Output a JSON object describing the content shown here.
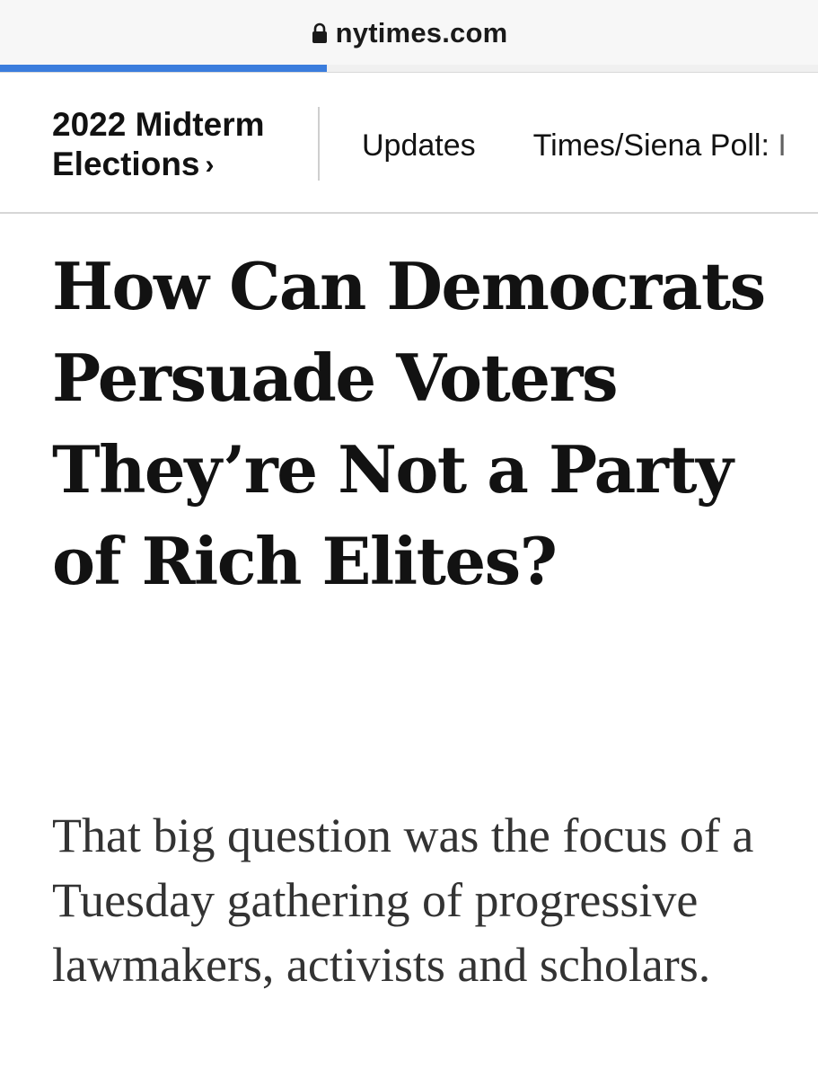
{
  "browser": {
    "url_text": "nytimes.com",
    "lock_icon": "lock-icon",
    "load_progress": 0.4,
    "accent_color": "#3b7ddd"
  },
  "section_nav": {
    "title": "2022 Midterm Elections",
    "chevron": "›",
    "links": [
      {
        "label": "Updates"
      },
      {
        "label": "Times/Siena Poll: I"
      }
    ]
  },
  "article": {
    "headline": "How Can Democrats Persuade Voters They’re Not a Party of Rich Elites?",
    "summary": "That big question was the focus of a Tuesday gathering of progressive lawmakers, activists and scholars."
  }
}
